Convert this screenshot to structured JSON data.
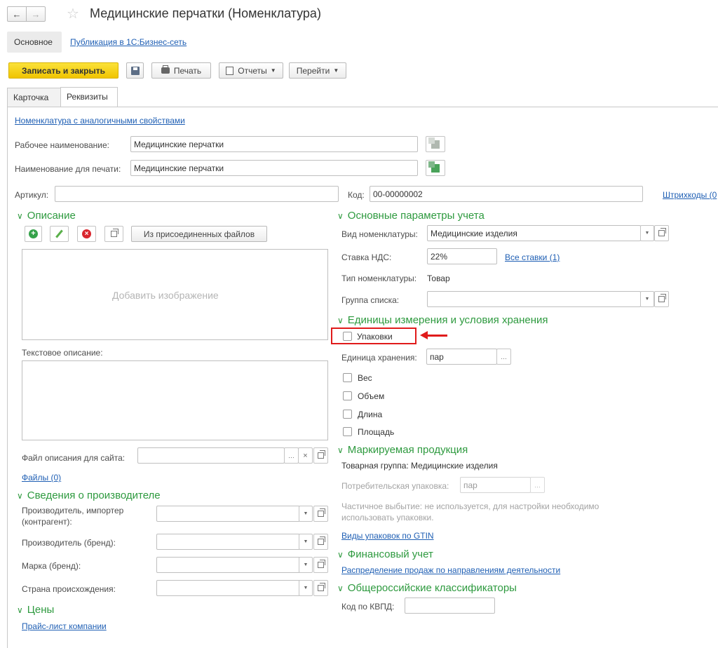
{
  "window": {
    "title": "Медицинские перчатки (Номенклатура)"
  },
  "nav": {
    "main": "Основное",
    "publication": "Публикация в 1С:Бизнес-сеть"
  },
  "toolbar": {
    "save_close": "Записать и закрыть",
    "print": "Печать",
    "reports": "Отчеты",
    "goto": "Перейти"
  },
  "tabs": {
    "card": "Карточка",
    "details": "Реквизиты"
  },
  "top": {
    "similar_link": "Номенклатура с аналогичными свойствами",
    "work_name_label": "Рабочее наименование:",
    "work_name_value": "Медицинские перчатки",
    "print_name_label": "Наименование для печати:",
    "print_name_value": "Медицинские перчатки",
    "article_label": "Артикул:",
    "article_value": "",
    "code_label": "Код:",
    "code_value": "00-00000002",
    "barcodes_link": "Штрихкоды (0"
  },
  "description": {
    "title": "Описание",
    "attached_files_button": "Из присоединенных файлов",
    "add_image": "Добавить изображение",
    "text_label": "Текстовое описание:",
    "site_file_label": "Файл описания для сайта:",
    "site_file_value": "",
    "files_link": "Файлы (0)"
  },
  "manufacturer": {
    "title": "Сведения о производителе",
    "producer_label_1": "Производитель, импортер",
    "producer_label_2": "(контрагент):",
    "brand_label": "Производитель (бренд):",
    "mark_label": "Марка (бренд):",
    "country_label": "Страна происхождения:"
  },
  "prices": {
    "title": "Цены",
    "price_list_link": "Прайс-лист компании"
  },
  "accounting": {
    "title": "Основные параметры учета",
    "kind_label": "Вид номенклатуры:",
    "kind_value": "Медицинские изделия",
    "vat_label": "Ставка НДС:",
    "vat_value": "22%",
    "all_rates_link": "Все ставки (1)",
    "type_label": "Тип номенклатуры:",
    "type_value": "Товар",
    "group_label": "Группа списка:",
    "group_value": ""
  },
  "units": {
    "title": "Единицы измерения и условия хранения",
    "packages_label": "Упаковки",
    "storage_unit_label": "Единица хранения:",
    "storage_unit_value": "пар",
    "weight_label": "Вес",
    "volume_label": "Объем",
    "length_label": "Длина",
    "area_label": "Площадь"
  },
  "marking": {
    "title": "Маркируемая продукция",
    "group_text": "Товарная группа: Медицинские изделия",
    "consumer_pack_label": "Потребительская упаковка:",
    "consumer_pack_value": "пар",
    "partial_line1": "Частичное выбытие: не используется, для настройки необходимо",
    "partial_line2": "использовать упаковки.",
    "gtin_link": "Виды упаковок по GTIN"
  },
  "finance": {
    "title": "Финансовый учет",
    "distribution_link": "Распределение продаж по направлениям деятельности"
  },
  "classifiers": {
    "title": "Общероссийские классификаторы",
    "kvpd_label": "Код по КВПД:",
    "kvpd_value": ""
  },
  "colors": {
    "accent_green": "#2e9a3f",
    "save_yellow": "#f5d21a",
    "link_blue": "#1f5fb4",
    "highlight_red": "#e01b1b"
  }
}
